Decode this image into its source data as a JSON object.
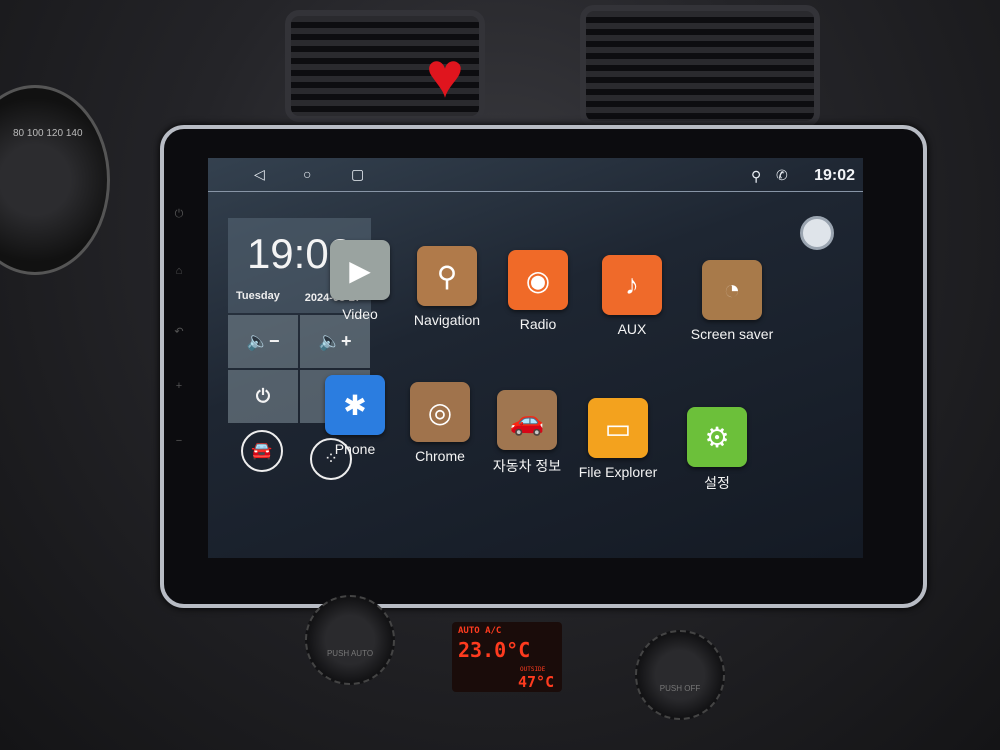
{
  "status_bar": {
    "time": "19:02",
    "icons": [
      "back-icon",
      "home-icon",
      "recents-icon",
      "location-icon",
      "phone-icon"
    ]
  },
  "clock_widget": {
    "time": "19:02",
    "day": "Tuesday",
    "date": "2024-08-27"
  },
  "quick_controls": [
    {
      "name": "volume-down",
      "icon": "🔈−"
    },
    {
      "name": "volume-up",
      "icon": "🔈+"
    },
    {
      "name": "power",
      "icon": "⏻"
    },
    {
      "name": "equalizer",
      "icon": "⚟"
    }
  ],
  "bottom_buttons": [
    {
      "name": "car",
      "icon": "🚘"
    },
    {
      "name": "apps",
      "icon": "⁘"
    }
  ],
  "apps": [
    {
      "label": "Video",
      "color": "#9aa3a0",
      "glyph": "▶"
    },
    {
      "label": "Navigation",
      "color": "#b07a4a",
      "glyph": "⚲"
    },
    {
      "label": "Radio",
      "color": "#f06a28",
      "glyph": "◉"
    },
    {
      "label": "AUX",
      "color": "#ef6a2a",
      "glyph": "♪"
    },
    {
      "label": "Screen saver",
      "color": "#a87a4a",
      "glyph": "◔"
    },
    {
      "label": "Phone",
      "color": "#2b7de0",
      "glyph": "✱"
    },
    {
      "label": "Chrome",
      "color": "#a0734c",
      "glyph": "◎"
    },
    {
      "label": "자동차 정보",
      "color": "#a07650",
      "glyph": "🚗"
    },
    {
      "label": "File Explorer",
      "color": "#f3a21e",
      "glyph": "▭"
    },
    {
      "label": "설정",
      "color": "#6cc03a",
      "glyph": "⚙"
    }
  ],
  "climate": {
    "mode": "AUTO A/C",
    "set_temp": "23.0°C",
    "outside_label": "OUTSIDE",
    "outside_temp": "47°C"
  },
  "knobs": {
    "left": "PUSH AUTO",
    "right": "PUSH OFF"
  },
  "gauge_ticks": "80 100 120 140"
}
